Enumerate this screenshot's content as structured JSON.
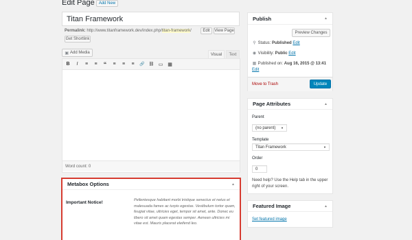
{
  "page": {
    "heading": "Edit Page",
    "add_new": "Add New"
  },
  "post": {
    "title": "Titan Framework",
    "permalink_label": "Permalink:",
    "permalink_base": "http://www.titanframework.dev/index.php/",
    "permalink_slug": "titan-framework",
    "permalink_end": "/",
    "edit_btn": "Edit",
    "view_btn": "View Page",
    "shortlink_btn": "Get Shortlink"
  },
  "editor": {
    "add_media": "Add Media",
    "tab_visual": "Visual",
    "tab_text": "Text",
    "toolbar": [
      "B",
      "I",
      "≡",
      "≡",
      "“",
      "≡",
      "≡",
      "≡",
      "🔗",
      "⛓",
      "▭",
      "▦"
    ],
    "word_count": "Word count: 0"
  },
  "metabox": {
    "title": "Metabox Options",
    "notice_label": "Important Notice!",
    "notice_text": "Pellentesque habitant morbi tristique senectus et netus et malesuada fames ac turpis egestas. Vestibulum tortor quam, feugiat vitae, ultricies eget, tempor sit amet, ante. Donec eu libero sit amet quam egestas semper. Aenean ultricies mi vitae est. Mauris placerat eleifend leo."
  },
  "publish": {
    "title": "Publish",
    "preview_btn": "Preview Changes",
    "status_label": "Status:",
    "status_value": "Published",
    "status_edit": "Edit",
    "visibility_label": "Visibility:",
    "visibility_value": "Public",
    "visibility_edit": "Edit",
    "published_label": "Published on:",
    "published_value": "Aug 16, 2015 @ 13:41",
    "published_edit": "Edit",
    "trash": "Move to Trash",
    "update": "Update"
  },
  "attributes": {
    "title": "Page Attributes",
    "parent_label": "Parent",
    "parent_value": "(no parent)",
    "template_label": "Template",
    "template_value": "Titan Framework",
    "order_label": "Order",
    "order_value": "0",
    "help": "Need help? Use the Help tab in the upper right of your screen."
  },
  "featured": {
    "title": "Featured Image",
    "set_link": "Set featured image"
  },
  "colors": {
    "accent": "#0085ba",
    "link": "#0073aa",
    "trash": "#a00",
    "highlight": "#fffbcc",
    "metabox_border": "#d63a2f"
  }
}
